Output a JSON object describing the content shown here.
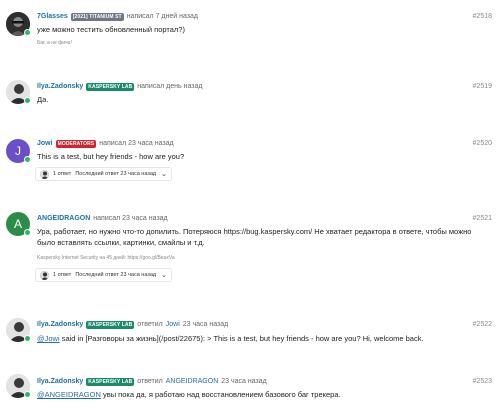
{
  "posts": [
    {
      "username": "7Glasses",
      "badge": "[2021] TITANIUM ST",
      "action": "написал 7 дней назад",
      "number": "#2518",
      "text": "уже можно тестить обновленный портал?)",
      "signature": "Баг, а не фича!"
    },
    {
      "username": "Ilya.Zadonsky",
      "badge": "KASPERSKY LAB",
      "action": "написал день назад",
      "number": "#2519",
      "text": "Да."
    },
    {
      "username": "Jowi",
      "badge": "MODERATORS",
      "avatar_letter": "J",
      "action": "написал 23 часа назад",
      "number": "#2520",
      "text": "This is a test, but hey friends - how are you?",
      "replies": {
        "count": "1 ответ",
        "last": "Последний ответ 23 часа назад"
      }
    },
    {
      "username": "ANGEIDRAGON",
      "avatar_letter": "A",
      "action": "написал 23 часа назад",
      "number": "#2521",
      "text": "Ура, работает, но нужно что-то допилить. Потеряюся https://bug.kaspersky.com/ Не хватает редактора в ответе, чтобы можно было вставлять ссылки, картинки, смайлы и т.д.",
      "signature": "Kaspersky Internet Security на 45 дней: https://goo.gl/BeuxVa",
      "replies": {
        "count": "1 ответ",
        "last": "Последний ответ 23 часа назад"
      }
    },
    {
      "username": "Ilya.Zadonsky",
      "badge": "KASPERSKY LAB",
      "action_prefix": "ответил",
      "action_target": "Jowi",
      "action_suffix": "23 часа назад",
      "number": "#2522",
      "mention": "@Jowi",
      "text": " said in [Разговоры за жизнь](/post/22675): > This is a test, but hey friends - how are you? Hi, welcome back."
    },
    {
      "username": "Ilya.Zadonsky",
      "badge": "KASPERSKY LAB",
      "action_prefix": "ответил",
      "action_target": "ANGEIDRAGON",
      "action_suffix": "23 часа назад",
      "number": "#2523",
      "mention": "@ANGEIDRAGON",
      "text": " увы пока да, я работаю над восстановлением базового баг трекера."
    }
  ],
  "colors": {
    "online": "#2fb36d",
    "link": "#1f6fa8",
    "badge_green": "#1b8a6b",
    "badge_red": "#d4252f",
    "badge_grey": "#6f7782",
    "avatar_jowi": "#6b4fc9",
    "avatar_angeidragon": "#2c8d4a"
  },
  "icons": {
    "chevron": "chevron-down-icon",
    "online": "online-dot-icon"
  }
}
